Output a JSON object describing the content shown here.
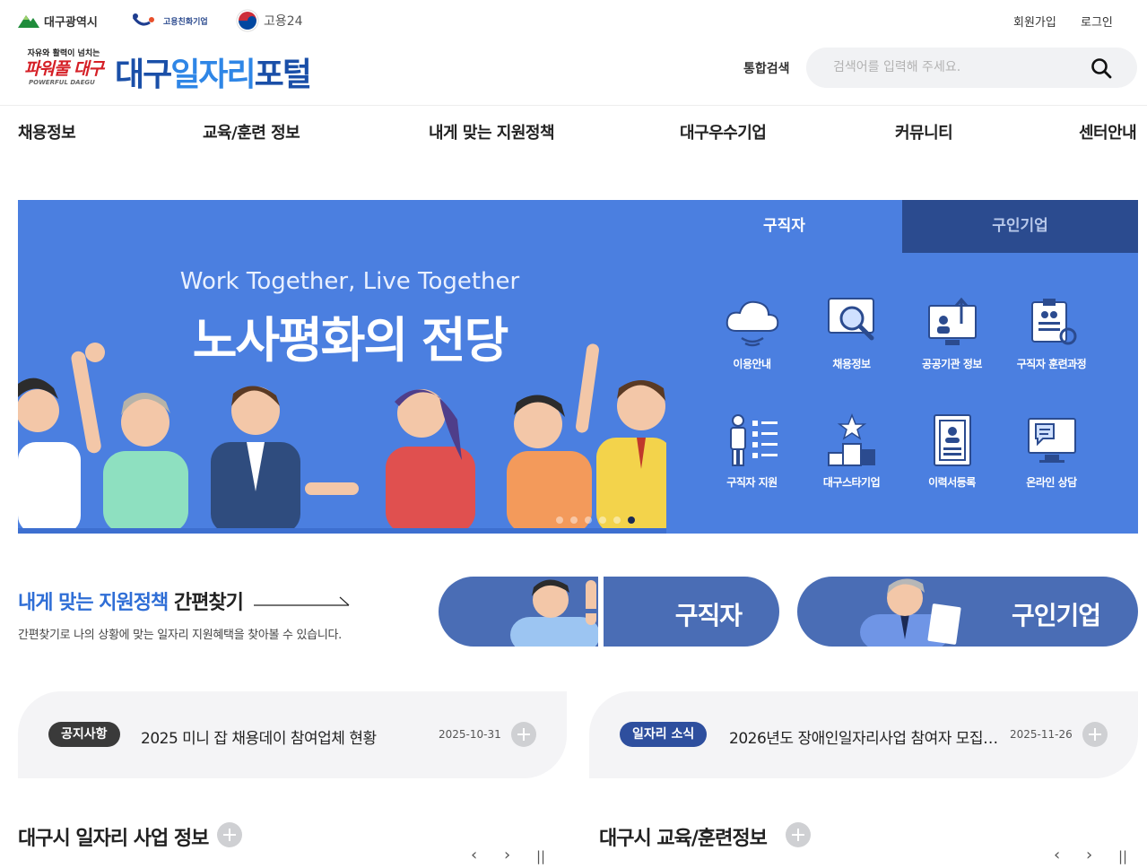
{
  "top_orgs": {
    "daegu": "대구광역시",
    "friendly": "고용친화기업",
    "goyong": "고용24"
  },
  "top_links": {
    "join": "회원가입",
    "login": "로그인"
  },
  "logo": {
    "slogan": "자유와 활력이 넘치는",
    "power": "파워풀 대구",
    "powerful": "POWERFUL DAEGU",
    "name_a": "대구",
    "name_b": "일자리",
    "name_c": "포털"
  },
  "search": {
    "label": "통합검색",
    "placeholder": "검색어를 입력해 주세요."
  },
  "gnb": [
    "채용정보",
    "교육/훈련 정보",
    "내게 맞는 지원정책",
    "대구우수기업",
    "커뮤니티",
    "센터안내"
  ],
  "hero": {
    "subtitle": "Work Together, Live Together",
    "title": "노사평화의 전당",
    "slide_count": 6,
    "active_slide": 6
  },
  "quick_tabs": {
    "active": "구직자",
    "inactive": "구인기업"
  },
  "quick_items": [
    "이용안내",
    "채용정보",
    "공공기관 정보",
    "구직자 훈련과정",
    "구직자 지원",
    "대구스타기업",
    "이력서등록",
    "온라인 상담"
  ],
  "quick_find": {
    "title_highlight": "내게 맞는 지원정책",
    "title_rest": " 간편찾기",
    "desc": "간편찾기로 나의 상황에 맞는 일자리 지원혜택을 찾아볼 수 있습니다.",
    "seeker": "구직자",
    "company": "구인기업"
  },
  "notices": [
    {
      "badge": "공지사항",
      "text": "2025 미니 잡 채용데이 참여업체 현황",
      "date": "2025-10-31"
    },
    {
      "badge": "일자리 소식",
      "text": "2026년도 장애인일자리사업 참여자 모집…",
      "date": "2025-11-26"
    }
  ],
  "sections": {
    "jobs": "대구시 일자리 사업 정보",
    "edu": "대구시 교육/훈련정보"
  },
  "controls": {
    "prev": "‹",
    "next": "›",
    "pause": "||"
  },
  "colors": {
    "hero_blue": "#4b7fe0",
    "tab_dark": "#2b4b8f",
    "pill_blue": "#4a6db5",
    "brand_red": "#d51f26",
    "brand_blue": "#1a4fa8"
  }
}
